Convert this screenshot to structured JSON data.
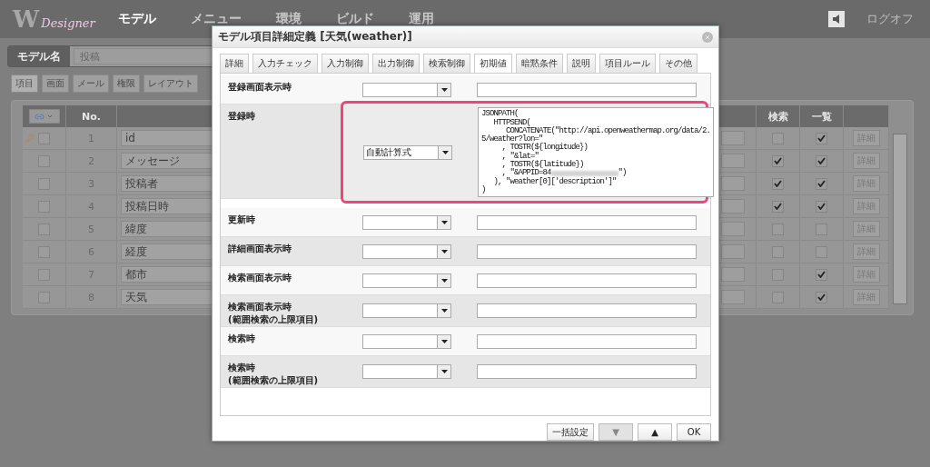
{
  "header": {
    "logo": {
      "mark": "W",
      "text": "Designer"
    },
    "nav": [
      {
        "label": "モデル",
        "selected": true
      },
      {
        "label": "メニュー",
        "selected": false
      },
      {
        "label": "環境",
        "selected": false
      },
      {
        "label": "ビルド",
        "selected": false
      },
      {
        "label": "運用",
        "selected": false
      }
    ],
    "logoff": "ログオフ"
  },
  "model_name": {
    "label": "モデル名",
    "value": "投稿"
  },
  "tabs": [
    {
      "label": "項目",
      "selected": true
    },
    {
      "label": "画面",
      "selected": false
    },
    {
      "label": "メール",
      "selected": false
    },
    {
      "label": "権限",
      "selected": false
    },
    {
      "label": "レイアウト",
      "selected": false
    }
  ],
  "table": {
    "columns": [
      "No.",
      "検索",
      "一覧"
    ],
    "rows": [
      {
        "key": true,
        "checked": false,
        "no": "1",
        "name": "id",
        "search": false,
        "list": true,
        "action": "詳細"
      },
      {
        "key": false,
        "checked": false,
        "no": "2",
        "name": "メッセージ",
        "search": true,
        "list": true,
        "action": "詳細"
      },
      {
        "key": false,
        "checked": false,
        "no": "3",
        "name": "投稿者",
        "search": true,
        "list": true,
        "action": "詳細"
      },
      {
        "key": false,
        "checked": false,
        "no": "4",
        "name": "投稿日時",
        "search": true,
        "list": true,
        "action": "詳細"
      },
      {
        "key": false,
        "checked": false,
        "no": "5",
        "name": "緯度",
        "search": false,
        "list": false,
        "action": "詳細"
      },
      {
        "key": false,
        "checked": false,
        "no": "6",
        "name": "経度",
        "search": false,
        "list": false,
        "action": "詳細"
      },
      {
        "key": false,
        "checked": false,
        "no": "7",
        "name": "都市",
        "search": false,
        "list": true,
        "action": "詳細"
      },
      {
        "key": false,
        "checked": false,
        "no": "8",
        "name": "天気",
        "search": false,
        "list": true,
        "action": "詳細"
      }
    ]
  },
  "dialog": {
    "title": "モデル項目詳細定義 [天気(weather)]",
    "tabs": [
      {
        "label": "詳細",
        "selected": false
      },
      {
        "label": "入力チェック",
        "selected": false
      },
      {
        "label": "入力制御",
        "selected": false
      },
      {
        "label": "出力制御",
        "selected": false
      },
      {
        "label": "検索制御",
        "selected": false
      },
      {
        "label": "初期値",
        "selected": true
      },
      {
        "label": "暗黙条件",
        "selected": false
      },
      {
        "label": "説明",
        "selected": false
      },
      {
        "label": "項目ルール",
        "selected": false
      },
      {
        "label": "その他",
        "selected": false
      }
    ],
    "rows": [
      {
        "label": "登録画面表示時",
        "mode": "",
        "highlighted": false
      },
      {
        "label": "登録時",
        "mode": "自動計算式",
        "highlighted": true,
        "formula": [
          {
            "text": "JSONPATH("
          },
          {
            "text": "   HTTPSEND("
          },
          {
            "text": "      CONCATENATE(\"http://api.openweathermap.org/data/2."
          },
          {
            "text": "5/weather?lon=\""
          },
          {
            "text": "     , TOSTR(${longitude})"
          },
          {
            "text": "     , \"&lat=\""
          },
          {
            "text": "     , TOSTR(${latitude})"
          },
          {
            "text": "     , \"&APPID=84",
            "redacted": true,
            "after": "\")"
          },
          {
            "text": "   ), \"weather[0]['description']\""
          },
          {
            "text": ")"
          }
        ]
      },
      {
        "label": "更新時",
        "mode": "",
        "highlighted": false
      },
      {
        "label": "詳細画面表示時",
        "mode": "",
        "highlighted": false
      },
      {
        "label": "検索画面表示時",
        "mode": "",
        "highlighted": false
      },
      {
        "label": "検索画面表示時\n(範囲検索の上限項目)",
        "mode": "",
        "highlighted": false
      },
      {
        "label": "検索時",
        "mode": "",
        "highlighted": false
      },
      {
        "label": "検索時\n(範囲検索の上限項目)",
        "mode": "",
        "highlighted": false
      }
    ],
    "buttons": [
      {
        "label": "一括設定",
        "disabled": false
      },
      {
        "label": "▼",
        "disabled": true
      },
      {
        "label": "▲",
        "disabled": false
      },
      {
        "label": "OK",
        "disabled": false
      }
    ]
  }
}
